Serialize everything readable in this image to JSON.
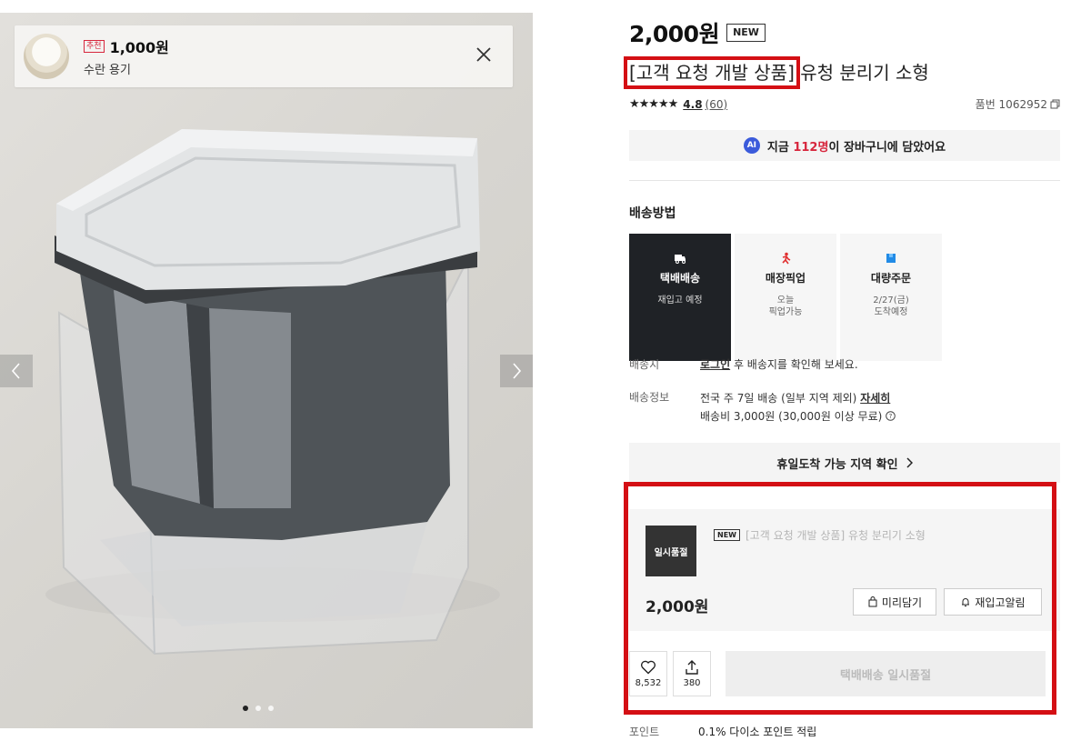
{
  "recommend": {
    "badge": "추천",
    "price": "1,000원",
    "name": "수란 용기"
  },
  "gallery": {
    "dots_total": 3,
    "active_index": 0
  },
  "product": {
    "price": "2,000원",
    "new_tag": "NEW",
    "title_prefix": "[고객 요청 개발 상품]",
    "title_rest": " 유청 분리기 소형",
    "stars": "★★★★★",
    "score": "4.8",
    "review_count": "(60)",
    "sku": "품번 1062952"
  },
  "ai_notice": {
    "badge": "AI",
    "text_before": "지금 ",
    "count": "112명",
    "text_after": "이 장바구니에 담았어요"
  },
  "shipping": {
    "title": "배송방법",
    "options": [
      {
        "name": "택배배송",
        "sub1": "재입고 예정",
        "sub2": "",
        "icon": "truck-icon",
        "selected": true
      },
      {
        "name": "매장픽업",
        "sub1": "오늘",
        "sub2": "픽업가능",
        "icon": "runner-icon",
        "selected": false
      },
      {
        "name": "대량주문",
        "sub1": "2/27(금)",
        "sub2": "도착예정",
        "icon": "box-icon",
        "selected": false
      }
    ],
    "dest_label": "배송지",
    "dest_link": "로그인",
    "dest_text": " 후 배송지를 확인해 보세요.",
    "info_label": "배송정보",
    "info_line1": "전국 주 7일 배송 (일부 지역 제외) ",
    "info_link": "자세히",
    "info_line2": "배송비 3,000원 (30,000원 이상 무료)"
  },
  "holiday": {
    "label": "휴일도착 가능 지역 확인"
  },
  "option_card": {
    "thumb_label": "일시품절",
    "new_tag": "NEW",
    "name": "[고객 요청 개발 상품] 유청 분리기 소형",
    "price": "2,000원",
    "preorder": "미리담기",
    "restock": "재입고알림"
  },
  "actions": {
    "likes": "8,532",
    "shares": "380",
    "soldout": "택배배송 일시품절"
  },
  "points": {
    "label": "포인트",
    "text": "0.1% 다이소 포인트 적립"
  },
  "colors": {
    "highlight": "#d40f14",
    "accent_red": "#d7263d",
    "ai_blue": "#3b5bdb",
    "selected_dark": "#1f2226"
  }
}
